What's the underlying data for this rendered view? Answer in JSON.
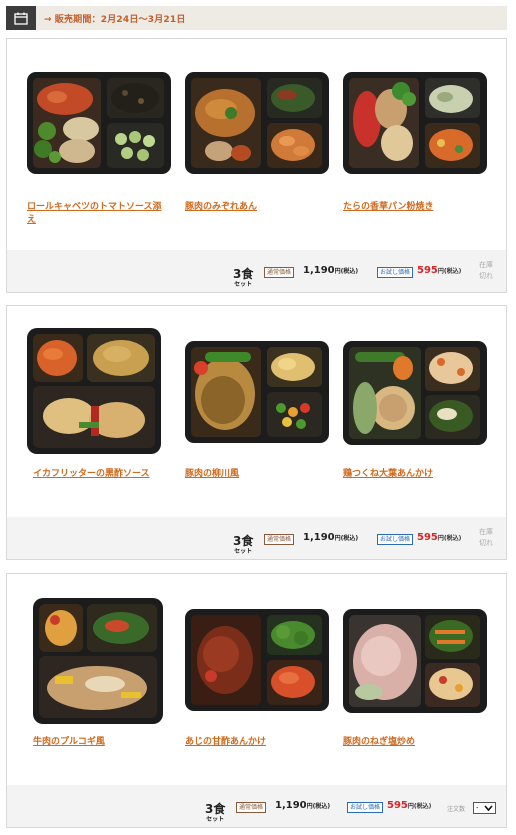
{
  "period": {
    "icon": "calendar-icon",
    "text": "販売期間：2月24日～3月21日",
    "arrow": "→"
  },
  "sets": [
    {
      "items": [
        {
          "name": "ロールキャベツのトマトソース添え"
        },
        {
          "name": "豚肉のみぞれあん"
        },
        {
          "name": "たらの香草パン粉焼き"
        }
      ],
      "set_count": "3食",
      "set_unit": "セット",
      "normal_badge": "通常価格",
      "normal_price": "1,190",
      "normal_tax": "円(税込)",
      "otoku_badge": "お試し価格",
      "otoku_price": "595",
      "otoku_tax": "円(税込)",
      "status": "在庫切れ"
    },
    {
      "items": [
        {
          "name": "イカフリッターの黒酢ソース"
        },
        {
          "name": "豚肉の柳川風"
        },
        {
          "name": "鶏つくね大葉あんかけ"
        }
      ],
      "set_count": "3食",
      "set_unit": "セット",
      "normal_badge": "通常価格",
      "normal_price": "1,190",
      "normal_tax": "円(税込)",
      "otoku_badge": "お試し価格",
      "otoku_price": "595",
      "otoku_tax": "円(税込)",
      "status": "在庫切れ"
    },
    {
      "items": [
        {
          "name": "牛肉のプルコギ風"
        },
        {
          "name": "あじの甘酢あんかけ"
        },
        {
          "name": "豚肉のねぎ塩炒め"
        }
      ],
      "set_count": "3食",
      "set_unit": "セット",
      "normal_badge": "通常価格",
      "normal_price": "1,190",
      "normal_tax": "円(税込)",
      "otoku_badge": "お試し価格",
      "otoku_price": "595",
      "otoku_tax": "円(税込)",
      "qty_label": "注文数",
      "qty_value": "-"
    }
  ],
  "colors": {
    "link": "#cf6a1f",
    "sale": "#d8262b",
    "tray": "#1c1c1c"
  }
}
